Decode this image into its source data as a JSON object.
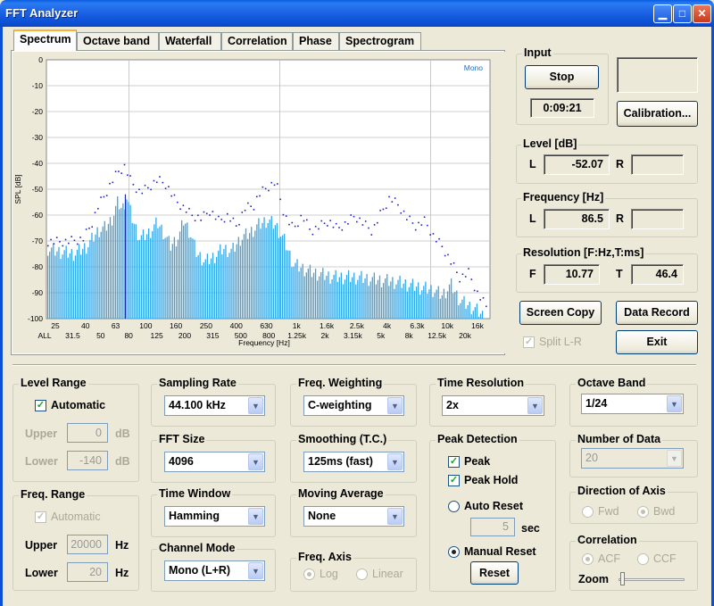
{
  "window": {
    "title": "FFT Analyzer",
    "min_glyph": "▁",
    "max_glyph": "□",
    "close_glyph": "✕"
  },
  "tabs": [
    "Spectrum",
    "Octave band",
    "Waterfall",
    "Correlation",
    "Phase",
    "Spectrogram"
  ],
  "active_tab": "Spectrum",
  "chart_data": {
    "type": "bar",
    "legend_text": "Mono",
    "ylabel": "SPL [dB]",
    "xlabel": "Frequency [Hz]",
    "ylim": [
      -100,
      0
    ],
    "yticks": [
      "0",
      "-10",
      "-20",
      "-30",
      "-40",
      "-50",
      "-60",
      "-70",
      "-80",
      "-90",
      "-100"
    ],
    "xticks_top": [
      "25",
      "40",
      "63",
      "100",
      "160",
      "250",
      "400",
      "630",
      "1k",
      "1.6k",
      "2.5k",
      "4k",
      "6.3k",
      "10k",
      "16k"
    ],
    "xticks_bottom": [
      "ALL",
      "31.5",
      "50",
      "80",
      "125",
      "200",
      "315",
      "500",
      "800",
      "1.25k",
      "2k",
      "3.15k",
      "5k",
      "8k",
      "12.5k",
      "20k"
    ],
    "bar_color": "#35a7e6",
    "peak_color": "#2020c8",
    "level_profile": [
      [
        0,
        -73
      ],
      [
        0.02,
        -74
      ],
      [
        0.06,
        -75
      ],
      [
        0.09,
        -72
      ],
      [
        0.115,
        -66
      ],
      [
        0.13,
        -65
      ],
      [
        0.145,
        -62
      ],
      [
        0.16,
        -55
      ],
      [
        0.17,
        -58
      ],
      [
        0.18,
        -53
      ],
      [
        0.19,
        -60
      ],
      [
        0.2,
        -65
      ],
      [
        0.21,
        -69
      ],
      [
        0.23,
        -67
      ],
      [
        0.25,
        -63
      ],
      [
        0.265,
        -67
      ],
      [
        0.28,
        -72
      ],
      [
        0.3,
        -68
      ],
      [
        0.31,
        -62
      ],
      [
        0.325,
        -67
      ],
      [
        0.34,
        -75
      ],
      [
        0.36,
        -78
      ],
      [
        0.38,
        -76
      ],
      [
        0.4,
        -73
      ],
      [
        0.42,
        -74
      ],
      [
        0.44,
        -69
      ],
      [
        0.46,
        -67
      ],
      [
        0.48,
        -64
      ],
      [
        0.5,
        -62
      ],
      [
        0.52,
        -64
      ],
      [
        0.54,
        -70
      ],
      [
        0.56,
        -79
      ],
      [
        0.6,
        -82
      ],
      [
        0.65,
        -84
      ],
      [
        0.7,
        -84
      ],
      [
        0.75,
        -85
      ],
      [
        0.8,
        -86
      ],
      [
        0.85,
        -88
      ],
      [
        0.88,
        -89
      ],
      [
        0.9,
        -91
      ],
      [
        0.92,
        -87
      ],
      [
        0.94,
        -93
      ],
      [
        0.96,
        -95
      ],
      [
        0.98,
        -97
      ],
      [
        1.0,
        -100
      ]
    ],
    "peak_profile": [
      [
        0,
        -70
      ],
      [
        0.04,
        -70
      ],
      [
        0.08,
        -69
      ],
      [
        0.1,
        -63
      ],
      [
        0.115,
        -56
      ],
      [
        0.13,
        -52
      ],
      [
        0.145,
        -47
      ],
      [
        0.16,
        -43
      ],
      [
        0.175,
        -41
      ],
      [
        0.19,
        -47
      ],
      [
        0.21,
        -51
      ],
      [
        0.23,
        -49
      ],
      [
        0.25,
        -46
      ],
      [
        0.27,
        -48
      ],
      [
        0.29,
        -54
      ],
      [
        0.31,
        -57
      ],
      [
        0.33,
        -60
      ],
      [
        0.35,
        -61
      ],
      [
        0.37,
        -58
      ],
      [
        0.39,
        -62
      ],
      [
        0.41,
        -60
      ],
      [
        0.43,
        -64
      ],
      [
        0.45,
        -57
      ],
      [
        0.47,
        -56
      ],
      [
        0.48,
        -52
      ],
      [
        0.5,
        -49
      ],
      [
        0.52,
        -47
      ],
      [
        0.54,
        -60
      ],
      [
        0.56,
        -65
      ],
      [
        0.58,
        -60
      ],
      [
        0.6,
        -66
      ],
      [
        0.62,
        -64
      ],
      [
        0.64,
        -62
      ],
      [
        0.66,
        -65
      ],
      [
        0.68,
        -63
      ],
      [
        0.7,
        -60
      ],
      [
        0.72,
        -63
      ],
      [
        0.74,
        -66
      ],
      [
        0.76,
        -59
      ],
      [
        0.78,
        -53
      ],
      [
        0.8,
        -56
      ],
      [
        0.82,
        -61
      ],
      [
        0.84,
        -64
      ],
      [
        0.86,
        -62
      ],
      [
        0.88,
        -68
      ],
      [
        0.9,
        -72
      ],
      [
        0.92,
        -78
      ],
      [
        0.94,
        -84
      ],
      [
        0.96,
        -82
      ],
      [
        0.98,
        -90
      ],
      [
        1.0,
        -95
      ]
    ]
  },
  "input": {
    "label": "Input",
    "stop_label": "Stop",
    "time": "0:09:21"
  },
  "calibration_label": "Calibration...",
  "level": {
    "label": "Level [dB]",
    "l_label": "L",
    "l_value": "-52.07",
    "r_label": "R",
    "r_value": ""
  },
  "frequency": {
    "label": "Frequency [Hz]",
    "l_label": "L",
    "l_value": "86.5",
    "r_label": "R",
    "r_value": ""
  },
  "resolution": {
    "label": "Resolution [F:Hz,T:ms]",
    "f_label": "F",
    "f_value": "10.77",
    "t_label": "T",
    "t_value": "46.4"
  },
  "actions": {
    "screen_copy": "Screen Copy",
    "data_record": "Data Record",
    "split_lr": "Split L-R",
    "exit": "Exit"
  },
  "level_range": {
    "label": "Level Range",
    "automatic": "Automatic",
    "upper_label": "Upper",
    "upper_value": "0",
    "lower_label": "Lower",
    "lower_value": "-140",
    "unit": "dB"
  },
  "freq_range": {
    "label": "Freq. Range",
    "automatic": "Automatic",
    "upper_label": "Upper",
    "upper_value": "20000",
    "lower_label": "Lower",
    "lower_value": "20",
    "unit": "Hz"
  },
  "sampling_rate": {
    "label": "Sampling Rate",
    "value": "44.100 kHz"
  },
  "fft_size": {
    "label": "FFT Size",
    "value": "4096"
  },
  "time_window": {
    "label": "Time Window",
    "value": "Hamming"
  },
  "channel_mode": {
    "label": "Channel Mode",
    "value": "Mono (L+R)"
  },
  "freq_weighting": {
    "label": "Freq. Weighting",
    "value": "C-weighting"
  },
  "smoothing": {
    "label": "Smoothing (T.C.)",
    "value": "125ms (fast)"
  },
  "moving_average": {
    "label": "Moving Average",
    "value": "None"
  },
  "freq_axis": {
    "label": "Freq. Axis",
    "log": "Log",
    "linear": "Linear"
  },
  "time_resolution": {
    "label": "Time Resolution",
    "value": "2x"
  },
  "peak_detection": {
    "label": "Peak Detection",
    "peak": "Peak",
    "peak_hold": "Peak Hold",
    "auto_reset": "Auto Reset",
    "sec_value": "5",
    "sec_unit": "sec",
    "manual_reset": "Manual Reset",
    "reset_button": "Reset"
  },
  "octave_band": {
    "label": "Octave Band",
    "value": "1/24"
  },
  "number_of_data": {
    "label": "Number of Data",
    "value": "20"
  },
  "direction_of_axis": {
    "label": "Direction of Axis",
    "fwd": "Fwd",
    "bwd": "Bwd"
  },
  "correlation": {
    "label": "Correlation",
    "acf": "ACF",
    "ccf": "CCF",
    "zoom": "Zoom"
  }
}
